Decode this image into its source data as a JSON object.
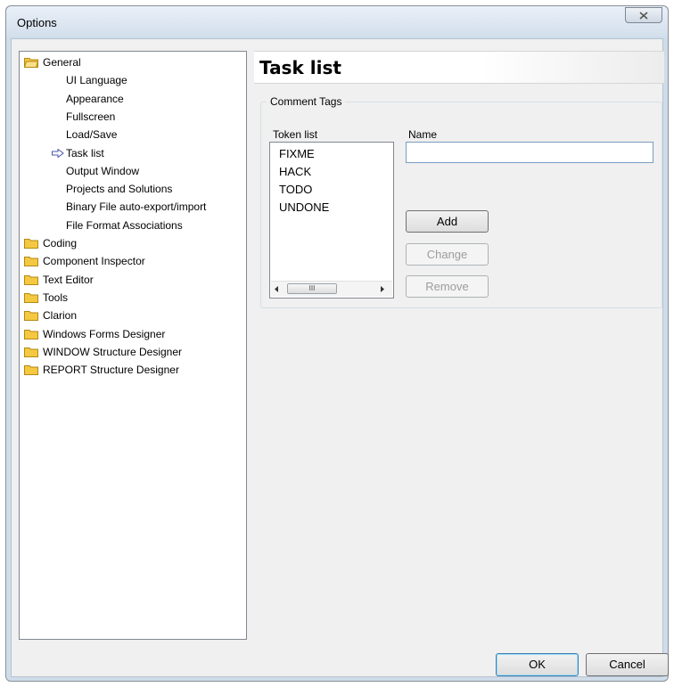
{
  "window": {
    "title": "Options"
  },
  "tree": {
    "items": [
      {
        "label": "General",
        "level": 0,
        "icon": "folder-open-icon"
      },
      {
        "label": "UI Language",
        "level": 1
      },
      {
        "label": "Appearance",
        "level": 1
      },
      {
        "label": "Fullscreen",
        "level": 1
      },
      {
        "label": "Load/Save",
        "level": 1
      },
      {
        "label": "Task list",
        "level": 1,
        "selected": true,
        "icon": "arrow-right-icon"
      },
      {
        "label": "Output Window",
        "level": 1
      },
      {
        "label": "Projects and Solutions",
        "level": 1
      },
      {
        "label": "Binary File auto-export/import",
        "level": 1
      },
      {
        "label": "File Format Associations",
        "level": 1
      },
      {
        "label": "Coding",
        "level": 0,
        "icon": "folder-icon"
      },
      {
        "label": "Component Inspector",
        "level": 0,
        "icon": "folder-icon"
      },
      {
        "label": "Text Editor",
        "level": 0,
        "icon": "folder-icon"
      },
      {
        "label": "Tools",
        "level": 0,
        "icon": "folder-icon"
      },
      {
        "label": "Clarion",
        "level": 0,
        "icon": "folder-icon"
      },
      {
        "label": "Windows Forms Designer",
        "level": 0,
        "icon": "folder-icon"
      },
      {
        "label": "WINDOW Structure Designer",
        "level": 0,
        "icon": "folder-icon"
      },
      {
        "label": "REPORT Structure Designer",
        "level": 0,
        "icon": "folder-icon"
      }
    ]
  },
  "panel": {
    "title": "Task list",
    "group_label": "Comment Tags",
    "token_list_label": "Token list",
    "tokens": [
      "FIXME",
      "HACK",
      "TODO",
      "UNDONE"
    ],
    "scroll_thumb_glyph": "III",
    "name_label": "Name",
    "name_value": "",
    "add_label": "Add",
    "change_label": "Change",
    "remove_label": "Remove"
  },
  "footer": {
    "ok_label": "OK",
    "cancel_label": "Cancel"
  },
  "colors": {
    "folder": "#f5c842",
    "selection_arrow": "#4b57a8",
    "title_bar": "#d3dfec"
  }
}
